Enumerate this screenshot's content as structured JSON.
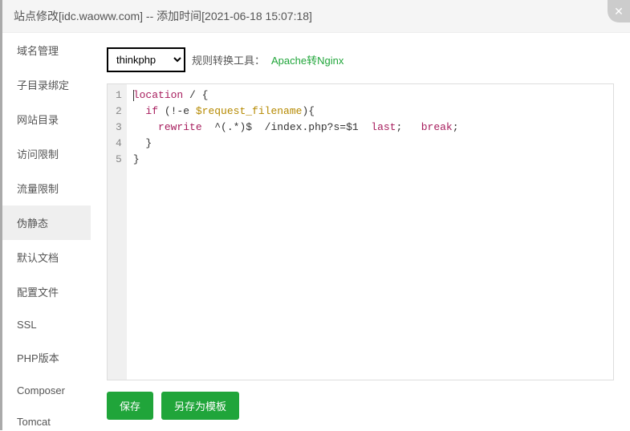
{
  "header": {
    "title": "站点修改[idc.waoww.com] -- 添加时间[2021-06-18 15:07:18]"
  },
  "sidebar": {
    "items": [
      {
        "label": "域名管理",
        "key": "domain-manage"
      },
      {
        "label": "子目录绑定",
        "key": "subdir-bind"
      },
      {
        "label": "网站目录",
        "key": "site-dir"
      },
      {
        "label": "访问限制",
        "key": "access-limit"
      },
      {
        "label": "流量限制",
        "key": "traffic-limit"
      },
      {
        "label": "伪静态",
        "key": "rewrite",
        "active": true
      },
      {
        "label": "默认文档",
        "key": "default-doc"
      },
      {
        "label": "配置文件",
        "key": "config-file"
      },
      {
        "label": "SSL",
        "key": "ssl"
      },
      {
        "label": "PHP版本",
        "key": "php-version"
      },
      {
        "label": "Composer",
        "key": "composer"
      },
      {
        "label": "Tomcat",
        "key": "tomcat"
      }
    ]
  },
  "toolbar": {
    "template_selected": "thinkphp",
    "convert_label": "规则转换工具：",
    "convert_link": "Apache转Nginx"
  },
  "editor": {
    "lines": [
      "location / {",
      "  if (!-e $request_filename){",
      "    rewrite  ^(.*)$  /index.php?s=$1  last;   break;",
      "  }",
      "}"
    ]
  },
  "actions": {
    "save": "保存",
    "save_as_template": "另存为模板"
  }
}
